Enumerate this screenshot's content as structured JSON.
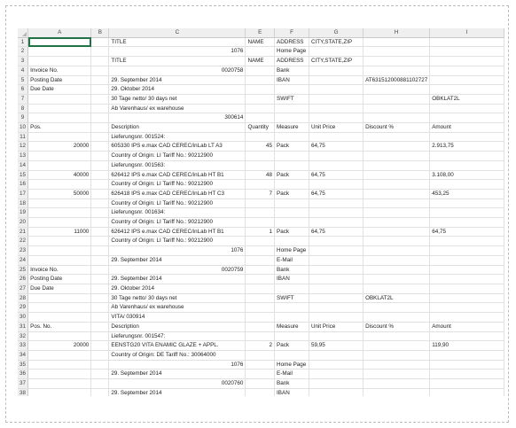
{
  "columns": [
    "A",
    "B",
    "C",
    "E",
    "F",
    "G",
    "H",
    "I"
  ],
  "rows": [
    {
      "n": "1",
      "a": "",
      "b": "",
      "c": "TITLE",
      "e": "NAME",
      "f": "ADDRESS",
      "g": "CITY,STATE,ZIP",
      "h": "",
      "i": ""
    },
    {
      "n": "2",
      "a": "",
      "b": "",
      "c": "1076",
      "e": "",
      "f": "Home Page",
      "g": "",
      "h": "",
      "i": ""
    },
    {
      "n": "3",
      "a": "",
      "b": "",
      "c": "TITLE",
      "e": "NAME",
      "f": "ADDRESS",
      "g": "CITY,STATE,ZIP",
      "h": "",
      "i": ""
    },
    {
      "n": "4",
      "a": "Invoice No.",
      "b": "",
      "c": "0020758",
      "e": "",
      "f": "Bank",
      "g": "",
      "h": "",
      "i": ""
    },
    {
      "n": "5",
      "a": "Posting Date",
      "b": "",
      "c": "29. September 2014",
      "e": "",
      "f": "IBAN",
      "g": "",
      "h": "AT631512000881102727",
      "i": ""
    },
    {
      "n": "6",
      "a": "Due Date",
      "b": "",
      "c": "29. Oktober 2014",
      "e": "",
      "f": "",
      "g": "",
      "h": "",
      "i": ""
    },
    {
      "n": "7",
      "a": "",
      "b": "",
      "c": "30 Tage netto/ 30 days net",
      "e": "",
      "f": "SWIFT",
      "g": "",
      "h": "",
      "i": "OBKLAT2L"
    },
    {
      "n": "8",
      "a": "",
      "b": "",
      "c": "Ab Varenhaus/ ex warehouse",
      "e": "",
      "f": "",
      "g": "",
      "h": "",
      "i": ""
    },
    {
      "n": "9",
      "a": "",
      "b": "",
      "c": "300614",
      "e": "",
      "f": "",
      "g": "",
      "h": "",
      "i": ""
    },
    {
      "n": "10",
      "a": "Pos.",
      "b": "",
      "c": "Description",
      "e": "Quantity",
      "f": "Measure",
      "g": "Unit Price",
      "h": "Discount %",
      "i": "Amount"
    },
    {
      "n": "11",
      "a": "",
      "b": "",
      "c": "Lieferungsnr. 001524:",
      "e": "",
      "f": "",
      "g": "",
      "h": "",
      "i": ""
    },
    {
      "n": "12",
      "a": "20000",
      "b": "",
      "c": "605330 IPS e.max CAD CEREC/inLab LT A3",
      "e": "45",
      "f": "Pack",
      "g": "64,75",
      "h": "",
      "i": "2.913,75"
    },
    {
      "n": "13",
      "a": "",
      "b": "",
      "c": "Country of Origin: LI  Tariff No.: 90212900",
      "e": "",
      "f": "",
      "g": "",
      "h": "",
      "i": ""
    },
    {
      "n": "14",
      "a": "",
      "b": "",
      "c": "Lieferungsnr. 001563:",
      "e": "",
      "f": "",
      "g": "",
      "h": "",
      "i": ""
    },
    {
      "n": "15",
      "a": "40000",
      "b": "",
      "c": "626412 IPS e.max CAD CEREC/inLab HT B1",
      "e": "48",
      "f": "Pack",
      "g": "64,75",
      "h": "",
      "i": "3.108,00"
    },
    {
      "n": "16",
      "a": "",
      "b": "",
      "c": "Country of Origin: LI  Tariff No.: 90212900",
      "e": "",
      "f": "",
      "g": "",
      "h": "",
      "i": ""
    },
    {
      "n": "17",
      "a": "50000",
      "b": "",
      "c": "626418 IPS e.max CAD CEREC/inLab HT C3",
      "e": "7",
      "f": "Pack",
      "g": "64,75",
      "h": "",
      "i": "453,25"
    },
    {
      "n": "18",
      "a": "",
      "b": "",
      "c": "Country of Origin: LI  Tariff No.: 90212900",
      "e": "",
      "f": "",
      "g": "",
      "h": "",
      "i": ""
    },
    {
      "n": "19",
      "a": "",
      "b": "",
      "c": "Lieferungsnr. 001634:",
      "e": "",
      "f": "",
      "g": "",
      "h": "",
      "i": ""
    },
    {
      "n": "20",
      "a": "",
      "b": "",
      "c": "Country of Origin: LI  Tariff No.: 90212900",
      "e": "",
      "f": "",
      "g": "",
      "h": "",
      "i": ""
    },
    {
      "n": "21",
      "a": "11000",
      "b": "",
      "c": "626412 IPS e.max CAD CEREC/inLab HT B1",
      "e": "1",
      "f": "Pack",
      "g": "64,75",
      "h": "",
      "i": "64,75"
    },
    {
      "n": "22",
      "a": "",
      "b": "",
      "c": "Country of Origin: LI  Tariff No.: 90212900",
      "e": "",
      "f": "",
      "g": "",
      "h": "",
      "i": ""
    },
    {
      "n": "23",
      "a": "",
      "b": "",
      "c": "1076",
      "e": "",
      "f": "Home Page",
      "g": "",
      "h": "",
      "i": ""
    },
    {
      "n": "24",
      "a": "",
      "b": "",
      "c": "29. September 2014",
      "e": "",
      "f": "E-Mail",
      "g": "",
      "h": "",
      "i": ""
    },
    {
      "n": "25",
      "a": "Invoice No.",
      "b": "",
      "c": "0020759",
      "e": "",
      "f": "Bank",
      "g": "",
      "h": "",
      "i": ""
    },
    {
      "n": "26",
      "a": "Posting Date",
      "b": "",
      "c": "29. September 2014",
      "e": "",
      "f": "IBAN",
      "g": "",
      "h": "",
      "i": ""
    },
    {
      "n": "27",
      "a": "Due Date",
      "b": "",
      "c": "29. Oktober 2014",
      "e": "",
      "f": "",
      "g": "",
      "h": "",
      "i": ""
    },
    {
      "n": "28",
      "a": "",
      "b": "",
      "c": "30 Tage netto/ 30 days net",
      "e": "",
      "f": "SWIFT",
      "g": "",
      "h": "OBKLAT2L",
      "i": ""
    },
    {
      "n": "29",
      "a": "",
      "b": "",
      "c": "Ab Varenhaus/ ex warehouse",
      "e": "",
      "f": "",
      "g": "",
      "h": "",
      "i": ""
    },
    {
      "n": "30",
      "a": "",
      "b": "",
      "c": "VITA/ 030914",
      "e": "",
      "f": "",
      "g": "",
      "h": "",
      "i": ""
    },
    {
      "n": "31",
      "a": "Pos.  No.",
      "b": "",
      "c": "Description",
      "e": "",
      "f": "Measure",
      "g": "Unit Price",
      "h": "Discount %",
      "i": "Amount"
    },
    {
      "n": "32",
      "a": "",
      "b": "",
      "c": "Lieferungsnr. 001547:",
      "e": "",
      "f": "",
      "g": "",
      "h": "",
      "i": ""
    },
    {
      "n": "33",
      "a": "20000",
      "b": "",
      "c": "EENSTG20  VITA ENAMIC GLAZE + APPL.",
      "e": "2",
      "f": "Pack",
      "g": "59,95",
      "h": "",
      "i": "119,90"
    },
    {
      "n": "34",
      "a": "",
      "b": "",
      "c": "Country of Origin: DE  Tariff No.: 30064000",
      "e": "",
      "f": "",
      "g": "",
      "h": "",
      "i": ""
    },
    {
      "n": "35",
      "a": "",
      "b": "",
      "c": "1076",
      "e": "",
      "f": "Home Page",
      "g": "",
      "h": "",
      "i": ""
    },
    {
      "n": "36",
      "a": "",
      "b": "",
      "c": "29. September 2014",
      "e": "",
      "f": "E-Mail",
      "g": "",
      "h": "",
      "i": ""
    },
    {
      "n": "37",
      "a": "",
      "b": "",
      "c": "0020760",
      "e": "",
      "f": "Bank",
      "g": "",
      "h": "",
      "i": ""
    },
    {
      "n": "38",
      "a": "",
      "b": "",
      "c": "29. September 2014",
      "e": "",
      "f": "IBAN",
      "g": "",
      "h": "",
      "i": ""
    },
    {
      "n": "39",
      "a": "",
      "b": "",
      "c": "29. Oktober 2014",
      "e": "",
      "f": "",
      "g": "",
      "h": "",
      "i": ""
    }
  ],
  "colors": {
    "grid": "#e1e1e1",
    "header_bg": "#efefef",
    "selection": "#217346"
  }
}
